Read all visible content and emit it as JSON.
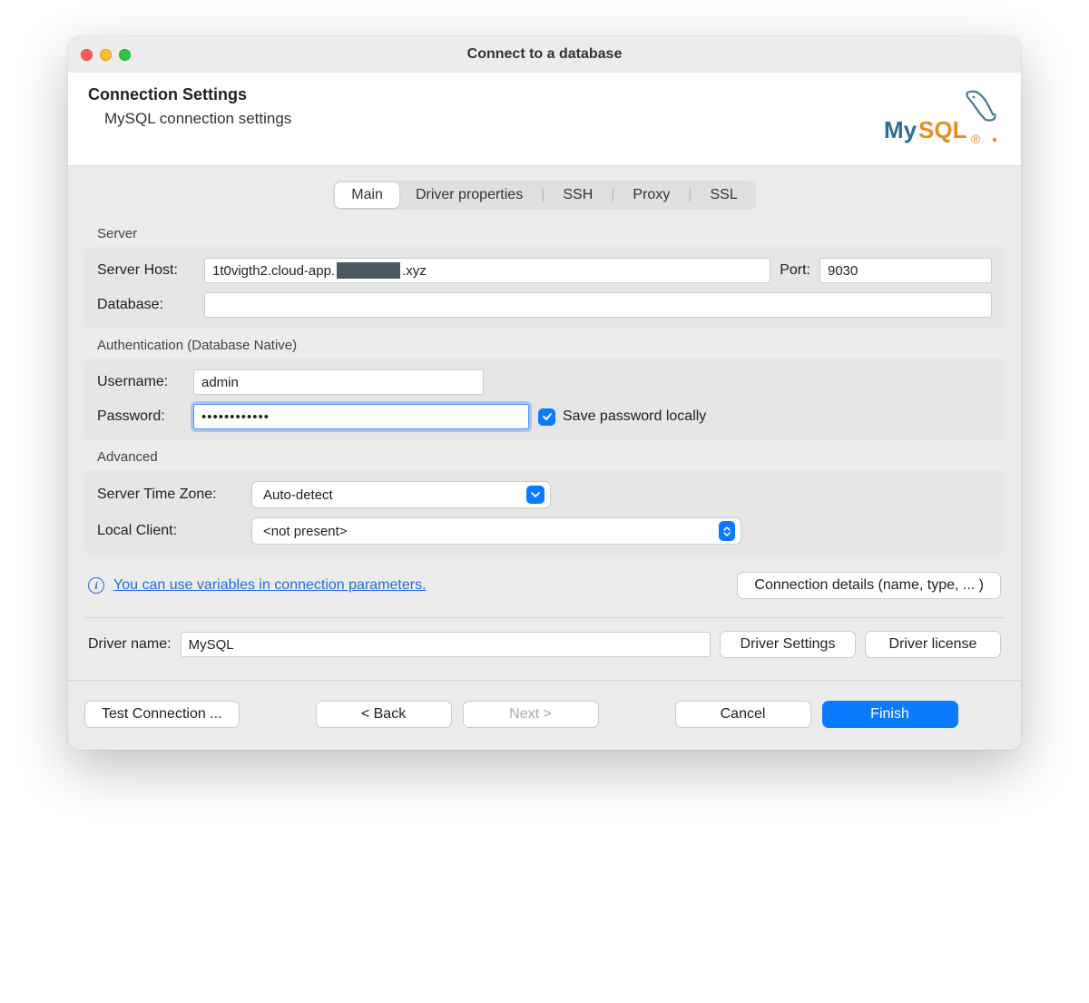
{
  "window": {
    "title": "Connect to a database"
  },
  "header": {
    "title": "Connection Settings",
    "subtitle": "MySQL connection settings",
    "logo_text": "MySQL"
  },
  "tabs": {
    "main": "Main",
    "driver": "Driver properties",
    "ssh": "SSH",
    "proxy": "Proxy",
    "ssl": "SSL"
  },
  "server": {
    "group_label": "Server",
    "host_label": "Server Host:",
    "host_prefix": "1t0vigth2.cloud-app.",
    "host_suffix": ".xyz",
    "port_label": "Port:",
    "port_value": "9030",
    "db_label": "Database:",
    "db_value": ""
  },
  "auth": {
    "group_label": "Authentication (Database Native)",
    "user_label": "Username:",
    "user_value": "admin",
    "pass_label": "Password:",
    "pass_value": "••••••••••••",
    "save_label": "Save password locally"
  },
  "advanced": {
    "group_label": "Advanced",
    "tz_label": "Server Time Zone:",
    "tz_value": "Auto-detect",
    "client_label": "Local Client:",
    "client_value": "<not present>"
  },
  "info": {
    "link_text": "You can use variables in connection parameters.",
    "details_btn": "Connection details (name, type, ... )"
  },
  "driver": {
    "name_label": "Driver name:",
    "name_value": "MySQL",
    "settings_btn": "Driver Settings",
    "license_btn": "Driver license"
  },
  "footer": {
    "test": "Test Connection ...",
    "back": "< Back",
    "next": "Next >",
    "cancel": "Cancel",
    "finish": "Finish"
  }
}
